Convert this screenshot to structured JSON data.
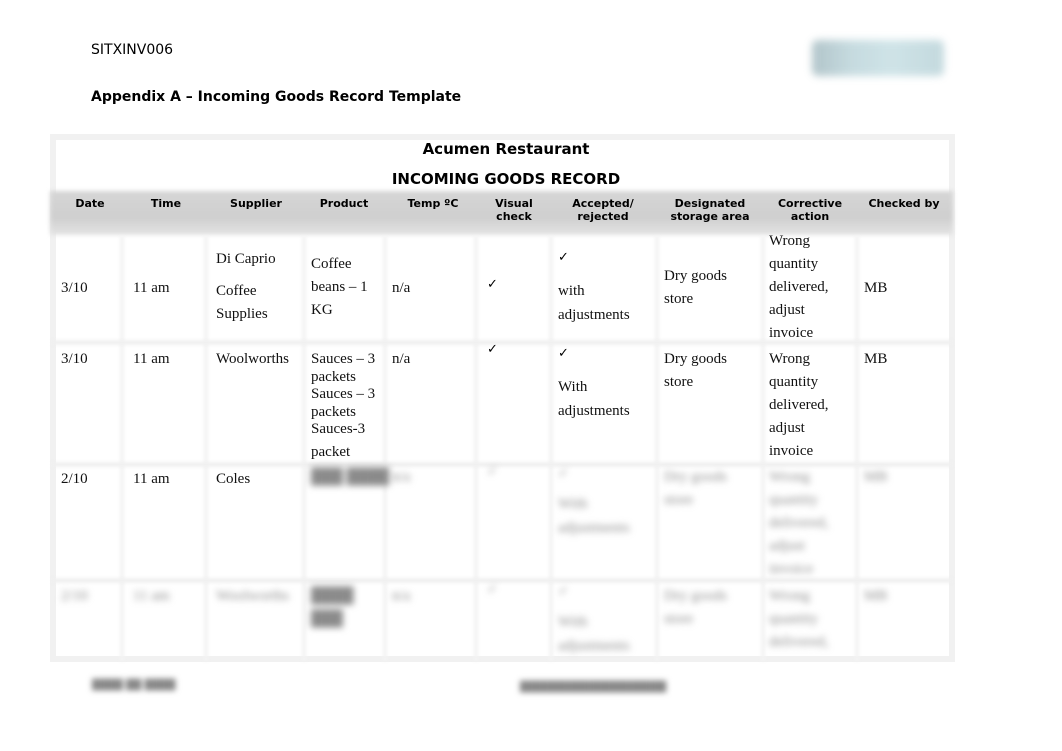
{
  "document": {
    "code": "SITXINV006",
    "appendix_title": "Appendix A – Incoming Goods Record Template",
    "logo": "organisation-logo"
  },
  "table": {
    "restaurant_name": "Acumen Restaurant",
    "record_title": "INCOMING GOODS RECORD",
    "columns": [
      "Date",
      "Time",
      "Supplier",
      "Product",
      "Temp ºC",
      "Visual\ncheck",
      "Accepted/\nrejected",
      "Designated\nstorage area",
      "Corrective\naction",
      "Checked by"
    ],
    "rows": [
      {
        "date": "3/10",
        "time": "11 am",
        "supplier_line1": "Di Caprio",
        "supplier_line2": "Coffee",
        "supplier_line3": "Supplies",
        "product": "Coffee\nbeans – 1\nKG",
        "temp": "n/a",
        "visual_check": "✓",
        "accepted_mark": "✓",
        "accepted_note": "with\nadjustments",
        "storage": "Dry goods\nstore",
        "corrective": "Wrong\nquantity\ndelivered,\nadjust\ninvoice",
        "checked_by": "MB"
      },
      {
        "date": "3/10",
        "time": "11 am",
        "supplier": "Woolworths",
        "product": "Sauces – 3\npackets\nSauces – 3\npackets\nSauces-3",
        "product_last": "packet",
        "temp": "n/a",
        "visual_check": "✓",
        "accepted_mark": "✓",
        "accepted_note": "With\nadjustments",
        "storage": "Dry goods\nstore",
        "corrective": "Wrong\nquantity\ndelivered,\nadjust\ninvoice",
        "checked_by": "MB"
      },
      {
        "date": "2/10",
        "time": "11 am",
        "supplier": "Coles",
        "product": "███ ████",
        "temp": "n/a",
        "visual_check": "✓",
        "accepted_mark": "✓",
        "accepted_note": "With\nadjustments",
        "storage": "Dry goods\nstore",
        "corrective": "Wrong\nquantity\ndelivered,\nadjust\ninvoice",
        "checked_by": "MB"
      },
      {
        "date": "2/10",
        "time": "11 am",
        "supplier": "Woolworths",
        "product": "████\n███",
        "temp": "n/a",
        "visual_check": "✓",
        "accepted_mark": "✓",
        "accepted_note": "With\nadjustments",
        "storage": "Dry goods\nstore",
        "corrective": "Wrong\nquantity\ndelivered,",
        "checked_by": "MB"
      }
    ]
  },
  "footer": {
    "left_text": "████ ██ ████",
    "right_text": "███████████████████"
  }
}
